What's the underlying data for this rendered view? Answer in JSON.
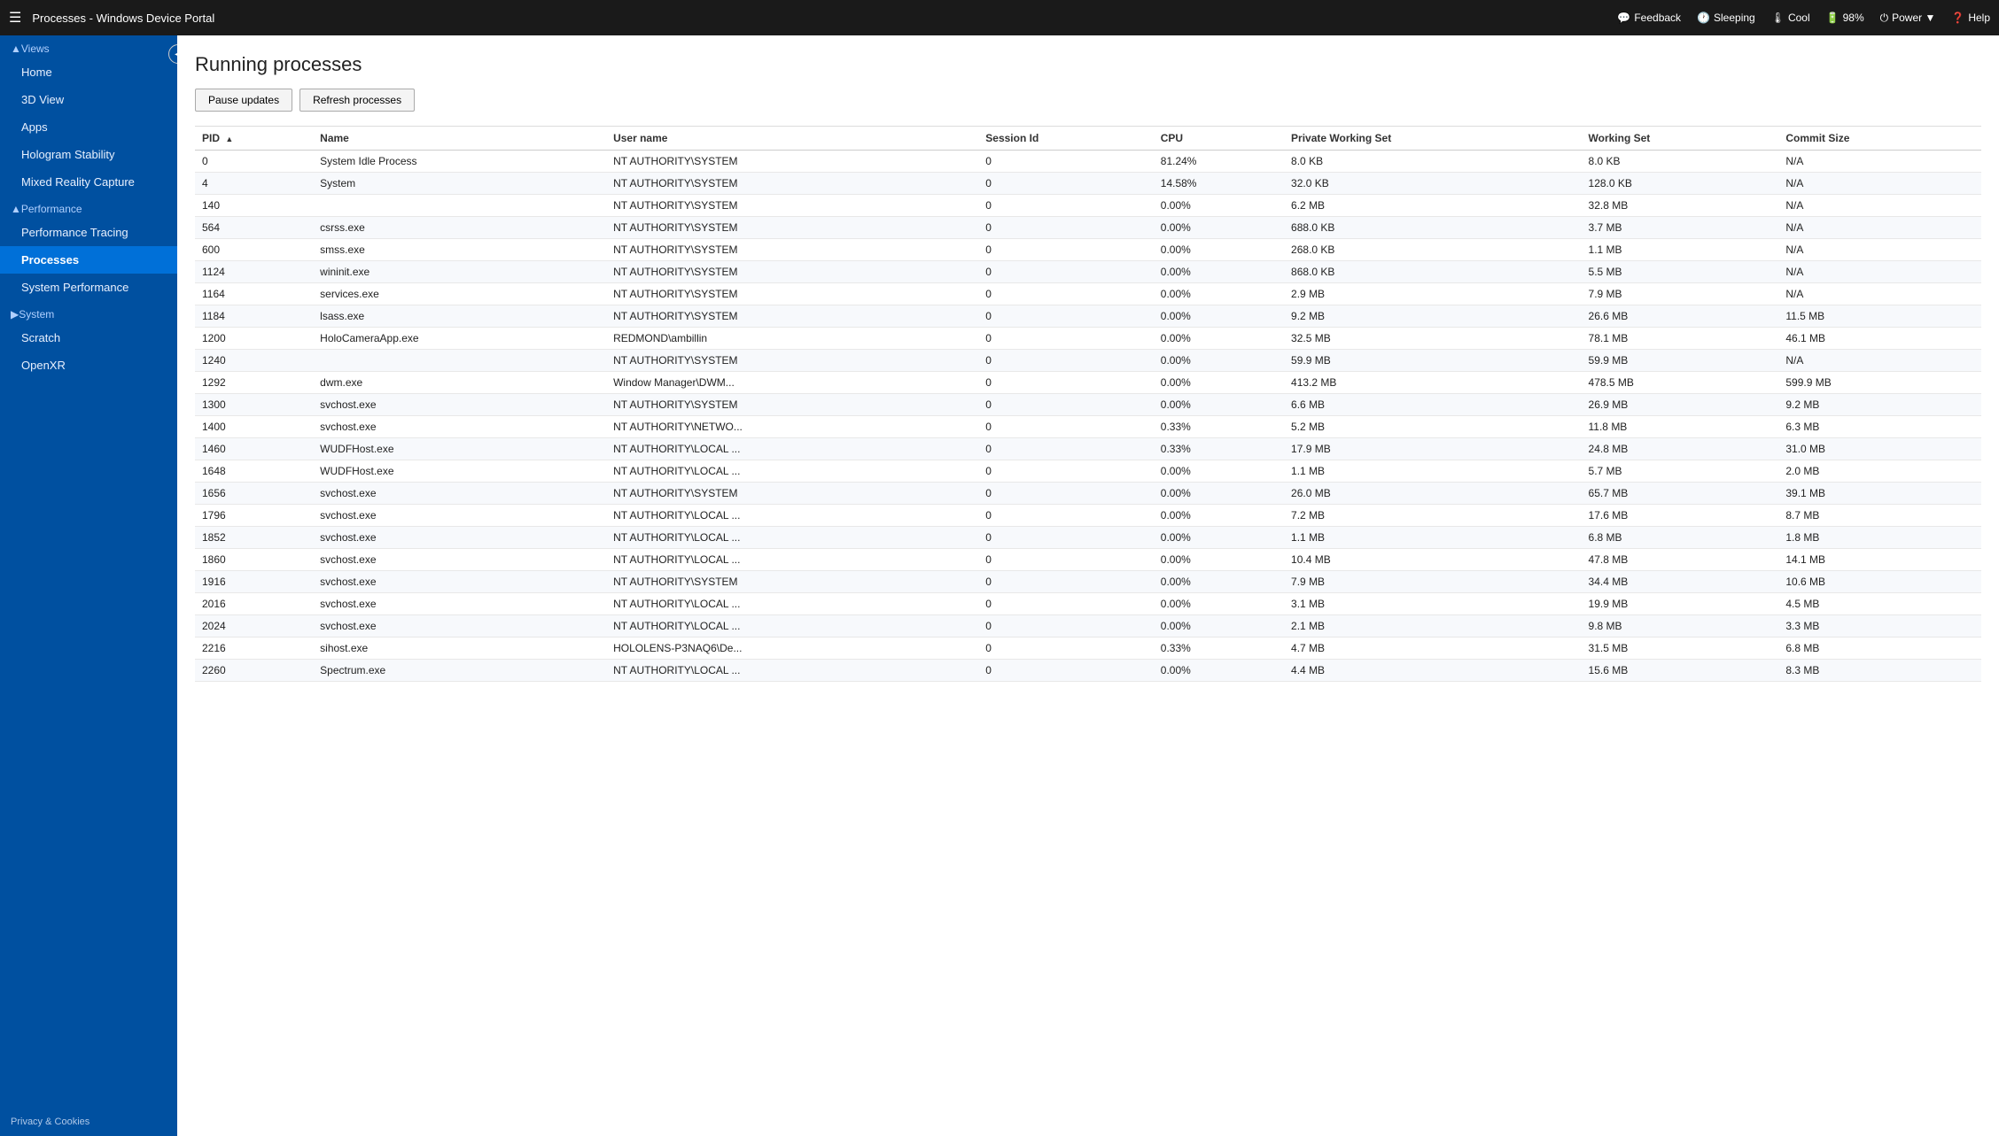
{
  "topbar": {
    "menu_icon": "≡",
    "title": "Processes - Windows Device Portal",
    "feedback_label": "Feedback",
    "sleeping_label": "Sleeping",
    "cool_label": "Cool",
    "battery_label": "98%",
    "power_label": "Power ▼",
    "help_label": "Help"
  },
  "sidebar": {
    "collapse_icon": "◀",
    "views_label": "▲Views",
    "items_views": [
      {
        "label": "Home",
        "active": false
      },
      {
        "label": "3D View",
        "active": false
      },
      {
        "label": "Apps",
        "active": false
      },
      {
        "label": "Hologram Stability",
        "active": false
      },
      {
        "label": "Mixed Reality Capture",
        "active": false
      }
    ],
    "performance_label": "▲Performance",
    "items_performance": [
      {
        "label": "Performance Tracing",
        "active": false
      },
      {
        "label": "Processes",
        "active": true
      },
      {
        "label": "System Performance",
        "active": false
      }
    ],
    "system_label": "▶System",
    "items_system": [
      {
        "label": "Scratch",
        "active": false
      },
      {
        "label": "OpenXR",
        "active": false
      }
    ],
    "privacy_label": "Privacy & Cookies"
  },
  "content": {
    "page_title": "Running processes",
    "pause_button": "Pause updates",
    "refresh_button": "Refresh processes",
    "table_headers": [
      "PID",
      "Name",
      "User name",
      "Session Id",
      "CPU",
      "Private Working Set",
      "Working Set",
      "Commit Size"
    ],
    "processes": [
      {
        "pid": "0",
        "name": "System Idle Process",
        "user": "NT AUTHORITY\\SYSTEM",
        "session": "0",
        "cpu": "81.24%",
        "private_ws": "8.0 KB",
        "ws": "8.0 KB",
        "commit": "N/A"
      },
      {
        "pid": "4",
        "name": "System",
        "user": "NT AUTHORITY\\SYSTEM",
        "session": "0",
        "cpu": "14.58%",
        "private_ws": "32.0 KB",
        "ws": "128.0 KB",
        "commit": "N/A"
      },
      {
        "pid": "140",
        "name": "",
        "user": "NT AUTHORITY\\SYSTEM",
        "session": "0",
        "cpu": "0.00%",
        "private_ws": "6.2 MB",
        "ws": "32.8 MB",
        "commit": "N/A"
      },
      {
        "pid": "564",
        "name": "csrss.exe",
        "user": "NT AUTHORITY\\SYSTEM",
        "session": "0",
        "cpu": "0.00%",
        "private_ws": "688.0 KB",
        "ws": "3.7 MB",
        "commit": "N/A"
      },
      {
        "pid": "600",
        "name": "smss.exe",
        "user": "NT AUTHORITY\\SYSTEM",
        "session": "0",
        "cpu": "0.00%",
        "private_ws": "268.0 KB",
        "ws": "1.1 MB",
        "commit": "N/A"
      },
      {
        "pid": "1124",
        "name": "wininit.exe",
        "user": "NT AUTHORITY\\SYSTEM",
        "session": "0",
        "cpu": "0.00%",
        "private_ws": "868.0 KB",
        "ws": "5.5 MB",
        "commit": "N/A"
      },
      {
        "pid": "1164",
        "name": "services.exe",
        "user": "NT AUTHORITY\\SYSTEM",
        "session": "0",
        "cpu": "0.00%",
        "private_ws": "2.9 MB",
        "ws": "7.9 MB",
        "commit": "N/A"
      },
      {
        "pid": "1184",
        "name": "lsass.exe",
        "user": "NT AUTHORITY\\SYSTEM",
        "session": "0",
        "cpu": "0.00%",
        "private_ws": "9.2 MB",
        "ws": "26.6 MB",
        "commit": "11.5 MB"
      },
      {
        "pid": "1200",
        "name": "HoloCameraApp.exe",
        "user": "REDMOND\\ambillin",
        "session": "0",
        "cpu": "0.00%",
        "private_ws": "32.5 MB",
        "ws": "78.1 MB",
        "commit": "46.1 MB"
      },
      {
        "pid": "1240",
        "name": "",
        "user": "NT AUTHORITY\\SYSTEM",
        "session": "0",
        "cpu": "0.00%",
        "private_ws": "59.9 MB",
        "ws": "59.9 MB",
        "commit": "N/A"
      },
      {
        "pid": "1292",
        "name": "dwm.exe",
        "user": "Window Manager\\DWM...",
        "session": "0",
        "cpu": "0.00%",
        "private_ws": "413.2 MB",
        "ws": "478.5 MB",
        "commit": "599.9 MB"
      },
      {
        "pid": "1300",
        "name": "svchost.exe",
        "user": "NT AUTHORITY\\SYSTEM",
        "session": "0",
        "cpu": "0.00%",
        "private_ws": "6.6 MB",
        "ws": "26.9 MB",
        "commit": "9.2 MB"
      },
      {
        "pid": "1400",
        "name": "svchost.exe",
        "user": "NT AUTHORITY\\NETWO...",
        "session": "0",
        "cpu": "0.33%",
        "private_ws": "5.2 MB",
        "ws": "11.8 MB",
        "commit": "6.3 MB"
      },
      {
        "pid": "1460",
        "name": "WUDFHost.exe",
        "user": "NT AUTHORITY\\LOCAL ...",
        "session": "0",
        "cpu": "0.33%",
        "private_ws": "17.9 MB",
        "ws": "24.8 MB",
        "commit": "31.0 MB"
      },
      {
        "pid": "1648",
        "name": "WUDFHost.exe",
        "user": "NT AUTHORITY\\LOCAL ...",
        "session": "0",
        "cpu": "0.00%",
        "private_ws": "1.1 MB",
        "ws": "5.7 MB",
        "commit": "2.0 MB"
      },
      {
        "pid": "1656",
        "name": "svchost.exe",
        "user": "NT AUTHORITY\\SYSTEM",
        "session": "0",
        "cpu": "0.00%",
        "private_ws": "26.0 MB",
        "ws": "65.7 MB",
        "commit": "39.1 MB"
      },
      {
        "pid": "1796",
        "name": "svchost.exe",
        "user": "NT AUTHORITY\\LOCAL ...",
        "session": "0",
        "cpu": "0.00%",
        "private_ws": "7.2 MB",
        "ws": "17.6 MB",
        "commit": "8.7 MB"
      },
      {
        "pid": "1852",
        "name": "svchost.exe",
        "user": "NT AUTHORITY\\LOCAL ...",
        "session": "0",
        "cpu": "0.00%",
        "private_ws": "1.1 MB",
        "ws": "6.8 MB",
        "commit": "1.8 MB"
      },
      {
        "pid": "1860",
        "name": "svchost.exe",
        "user": "NT AUTHORITY\\LOCAL ...",
        "session": "0",
        "cpu": "0.00%",
        "private_ws": "10.4 MB",
        "ws": "47.8 MB",
        "commit": "14.1 MB"
      },
      {
        "pid": "1916",
        "name": "svchost.exe",
        "user": "NT AUTHORITY\\SYSTEM",
        "session": "0",
        "cpu": "0.00%",
        "private_ws": "7.9 MB",
        "ws": "34.4 MB",
        "commit": "10.6 MB"
      },
      {
        "pid": "2016",
        "name": "svchost.exe",
        "user": "NT AUTHORITY\\LOCAL ...",
        "session": "0",
        "cpu": "0.00%",
        "private_ws": "3.1 MB",
        "ws": "19.9 MB",
        "commit": "4.5 MB"
      },
      {
        "pid": "2024",
        "name": "svchost.exe",
        "user": "NT AUTHORITY\\LOCAL ...",
        "session": "0",
        "cpu": "0.00%",
        "private_ws": "2.1 MB",
        "ws": "9.8 MB",
        "commit": "3.3 MB"
      },
      {
        "pid": "2216",
        "name": "sihost.exe",
        "user": "HOLOLENS-P3NAQ6\\De...",
        "session": "0",
        "cpu": "0.33%",
        "private_ws": "4.7 MB",
        "ws": "31.5 MB",
        "commit": "6.8 MB"
      },
      {
        "pid": "2260",
        "name": "Spectrum.exe",
        "user": "NT AUTHORITY\\LOCAL ...",
        "session": "0",
        "cpu": "0.00%",
        "private_ws": "4.4 MB",
        "ws": "15.6 MB",
        "commit": "8.3 MB"
      }
    ]
  }
}
